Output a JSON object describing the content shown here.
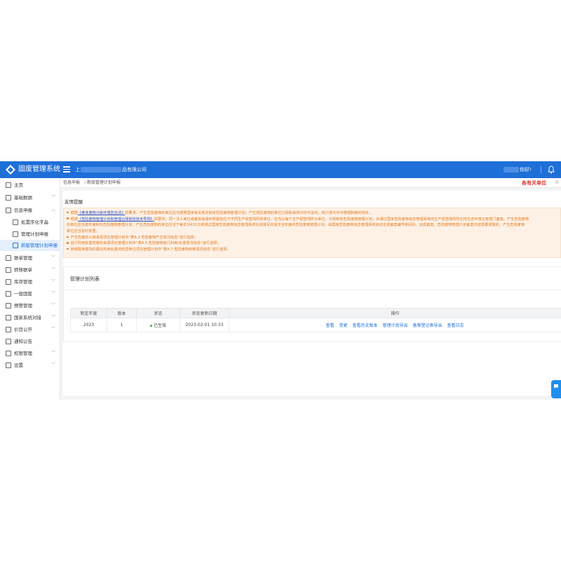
{
  "header": {
    "app_title": "固废管理系统",
    "company_prefix": "上",
    "company_suffix": "品有限公司",
    "greeting": "你好!"
  },
  "sidebar": {
    "items": [
      {
        "label": "主页",
        "icon": "home-icon"
      },
      {
        "label": "基础数据",
        "icon": "grid-icon"
      },
      {
        "label": "信息申报",
        "icon": "doc-icon"
      },
      {
        "label": "処置序化字晶",
        "icon": "file-icon"
      },
      {
        "label": "管理计划申报",
        "icon": "clipboard-icon"
      },
      {
        "label": "新版管理计划申报",
        "icon": "doc-edit-icon"
      },
      {
        "label": "联单管理",
        "icon": "list-icon"
      },
      {
        "label": "转移联单",
        "icon": "transfer-icon"
      },
      {
        "label": "库存管理",
        "icon": "box-icon"
      },
      {
        "label": "一般固废",
        "icon": "layers-icon"
      },
      {
        "label": "预警管理",
        "icon": "alert-icon"
      },
      {
        "label": "国家系统对接",
        "icon": "link-icon"
      },
      {
        "label": "价目公开",
        "icon": "price-icon"
      },
      {
        "label": "通知公告",
        "icon": "bell-icon"
      },
      {
        "label": "权限管理",
        "icon": "lock-icon"
      },
      {
        "label": "设置",
        "icon": "gear-icon"
      }
    ]
  },
  "breadcrumb": {
    "items": [
      "信息申报",
      "新版管理计划申报"
    ],
    "separator": ">",
    "unit_label": "各有关单位",
    "more_label": "ℬ"
  },
  "notice": {
    "title": "友情提醒",
    "lines": [
      {
        "before": "根据",
        "link": "《某体废物污染环境防治法》",
        "after": "的要求，产生危险废物的单位应当按照国家有关规定制定危险废物管理计划；产生危险废物的单位已经取得排污许可证的，执行排污许可管理制度的规定；"
      },
      {
        "before": "根据",
        "link": "《危险废物管理计划和管理台账制定技术导则》",
        "after": "的要求，同一法人单位或者其他组织所属但位于不同生产经营场所的单位，应当以每个生产经营场所为单位，分别制定危险废物管理计划，并通过国家危险废物信息管理系统向生产经营场所所在地生态环境主管部门备案。产生危险废物"
      },
      {
        "before": "",
        "link": "",
        "after": "的单位应当按年度制定危险废物管理计划；产生危险废物的单位应当于每年3月31日前通过国家危险废物信息管理系统在线填写并提交当年度的危险废物管理计划，由国家危险废物信息管理系统自动生成备案编号和回执，完成备案。危险废物管理计划备案内容需要调整的，产生危险废物"
      },
      {
        "before": "",
        "link": "",
        "after": "单位应当及时变更；"
      },
      {
        "before": "产生危废的入库来源须在管理计划中“表A.3 危险废物产生情况信息”进行选择；",
        "link": "",
        "after": ""
      },
      {
        "before": "自行利用处置危废的来源须在管理计划中“表A.5 危险废物自行利用/处置情况信息”进行选择；",
        "link": "",
        "after": ""
      },
      {
        "before": "转移联单模块的委托利用处置的经营单位须在管理计划中“表A.7 危险废物转移情况信息”进行选择；",
        "link": "",
        "after": ""
      }
    ]
  },
  "plan_list": {
    "title": "管理计划列表",
    "columns": [
      "制定年度",
      "版本",
      "状态",
      "状态更新日期",
      "操作"
    ],
    "rows": [
      {
        "year": "2023",
        "version": "1",
        "status": "已生效",
        "updated": "2023-02-01 10:33",
        "actions": [
          "查看",
          "变更",
          "查看历史版本",
          "管理计划导出",
          "备案登记表导出",
          "查看日志"
        ]
      }
    ]
  },
  "colors": {
    "primary": "#1f6fd8",
    "notice_text": "#e07b1f",
    "notice_bg": "#fdf1e6",
    "unit_red": "#e0302a",
    "status_green": "#36b04a"
  }
}
